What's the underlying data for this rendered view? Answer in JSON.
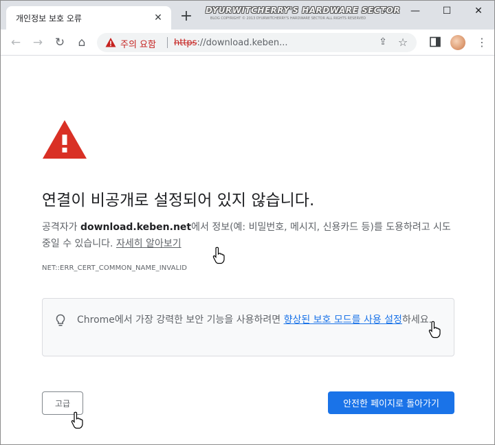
{
  "tab": {
    "title": "개인정보 보호 오류",
    "close_symbol": "✕",
    "new_tab_symbol": "+"
  },
  "watermark": {
    "main": "DYURWITCHERRY'S HARDWARE SECTOR",
    "sub": "BLOG COPYRIGHT © 2013 DYURWITCHERRY'S HARDWARE SECTOR ALL RIGHTS RESERVED"
  },
  "window_controls": {
    "tab_search_symbol": "⌄",
    "minimize_symbol": "—",
    "maximize_symbol": "☐",
    "close_symbol": "✕"
  },
  "toolbar": {
    "back_symbol": "←",
    "forward_symbol": "→",
    "reload_symbol": "↻",
    "home_symbol": "⌂",
    "security_label": "주의 요함",
    "url_scheme": "https",
    "url_rest": "://download.keben...",
    "share_symbol": "⇪",
    "star_symbol": "☆",
    "menu_symbol": "⋮"
  },
  "page": {
    "headline": "연결이 비공개로 설정되어 있지 않습니다.",
    "explanation_before": "공격자가 ",
    "explanation_host": "download.keben.net",
    "explanation_after": "에서 정보(예: 비밀번호, 메시지, 신용카드 등)를 도용하려고 시도 중일 수 있습니다. ",
    "learn_more": "자세히 알아보기",
    "error_code": "NET::ERR_CERT_COMMON_NAME_INVALID",
    "enhanced_before": "Chrome에서 가장 강력한 보안 기능을 사용하려면 ",
    "enhanced_link": "향상된 보호 모드를 사용 설정",
    "enhanced_after": "하세요.",
    "advanced_button": "고급",
    "back_to_safety_button": "안전한 페이지로 돌아가기"
  },
  "icons": {
    "warning": "warning-triangle-icon",
    "bulb": "lightbulb-icon",
    "cursor": "hand-pointer-cursor-icon"
  },
  "colors": {
    "warning_red": "#d93025",
    "link_blue": "#1a73e8",
    "primary_button": "#1a73e8"
  }
}
